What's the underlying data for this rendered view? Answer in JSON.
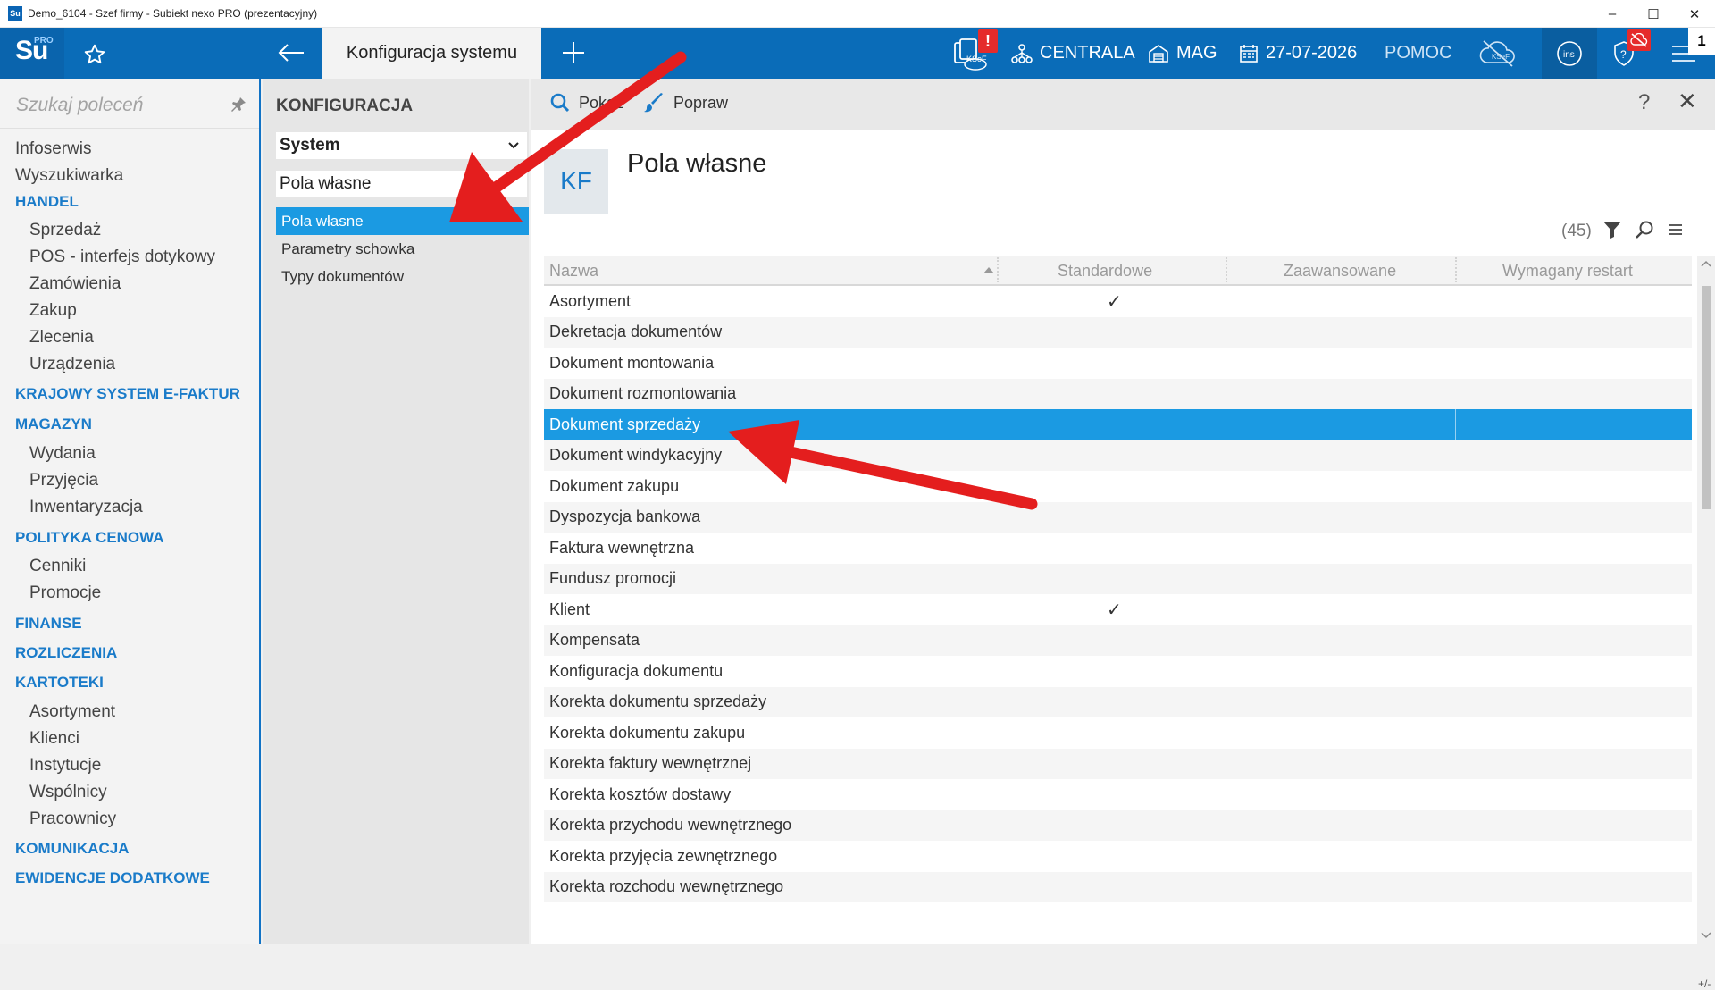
{
  "window": {
    "icon_text": "Su",
    "title": "Demo_6104 - Szef firmy - Subiekt nexo PRO (prezentacyjny)",
    "minimize": "–",
    "maximize": "☐",
    "close": "✕"
  },
  "header": {
    "logo_su": "Su",
    "logo_pro": "PRO",
    "active_tab": "Konfiguracja systemu",
    "ksef_label": "KSeF",
    "alert_badge": "!",
    "centrala": "CENTRALA",
    "mag": "MAG",
    "date": "27-07-2026",
    "pomoc": "POMOC",
    "ins_label": "ins",
    "counter": "1"
  },
  "sidebar": {
    "search_placeholder": "Szukaj poleceń",
    "items": [
      {
        "label": "Infoserwis",
        "type": "item"
      },
      {
        "label": "Wyszukiwarka",
        "type": "item"
      },
      {
        "label": "HANDEL",
        "type": "head"
      },
      {
        "label": "Sprzedaż",
        "type": "sub"
      },
      {
        "label": "POS - interfejs dotykowy",
        "type": "sub"
      },
      {
        "label": "Zamówienia",
        "type": "sub"
      },
      {
        "label": "Zakup",
        "type": "sub"
      },
      {
        "label": "Zlecenia",
        "type": "sub"
      },
      {
        "label": "Urządzenia",
        "type": "sub"
      },
      {
        "label": "KRAJOWY SYSTEM E-FAKTUR",
        "type": "head"
      },
      {
        "label": "MAGAZYN",
        "type": "head"
      },
      {
        "label": "Wydania",
        "type": "sub"
      },
      {
        "label": "Przyjęcia",
        "type": "sub"
      },
      {
        "label": "Inwentaryzacja",
        "type": "sub"
      },
      {
        "label": "POLITYKA CENOWA",
        "type": "head"
      },
      {
        "label": "Cenniki",
        "type": "sub"
      },
      {
        "label": "Promocje",
        "type": "sub"
      },
      {
        "label": "FINANSE",
        "type": "head"
      },
      {
        "label": "ROZLICZENIA",
        "type": "head"
      },
      {
        "label": "KARTOTEKI",
        "type": "head"
      },
      {
        "label": "Asortyment",
        "type": "sub"
      },
      {
        "label": "Klienci",
        "type": "sub"
      },
      {
        "label": "Instytucje",
        "type": "sub"
      },
      {
        "label": "Wspólnicy",
        "type": "sub"
      },
      {
        "label": "Pracownicy",
        "type": "sub"
      },
      {
        "label": "KOMUNIKACJA",
        "type": "head"
      },
      {
        "label": "EWIDENCJE DODATKOWE",
        "type": "head"
      }
    ]
  },
  "config": {
    "title": "KONFIGURACJA",
    "select_value": "System",
    "filter_value": "Pola własne",
    "items": [
      {
        "label": "Pola własne",
        "active": true
      },
      {
        "label": "Parametry schowka",
        "active": false
      },
      {
        "label": "Typy dokumentów",
        "active": false
      }
    ]
  },
  "toolbar": {
    "show_label": "Pokaż",
    "edit_label": "Popraw",
    "help": "?",
    "close": "✕"
  },
  "page": {
    "badge": "KF",
    "heading": "Pola własne",
    "count": "(45)"
  },
  "table": {
    "columns": [
      "Nazwa",
      "Standardowe",
      "Zaawansowane",
      "Wymagany restart"
    ],
    "check_mark": "✓",
    "rows": [
      {
        "name": "Asortyment",
        "std": true
      },
      {
        "name": "Dekretacja dokumentów",
        "std": false
      },
      {
        "name": "Dokument montowania",
        "std": false
      },
      {
        "name": "Dokument rozmontowania",
        "std": false
      },
      {
        "name": "Dokument sprzedaży",
        "std": false,
        "selected": true
      },
      {
        "name": "Dokument windykacyjny",
        "std": false
      },
      {
        "name": "Dokument zakupu",
        "std": false
      },
      {
        "name": "Dyspozycja bankowa",
        "std": false
      },
      {
        "name": "Faktura wewnętrzna",
        "std": false
      },
      {
        "name": "Fundusz promocji",
        "std": false
      },
      {
        "name": "Klient",
        "std": true
      },
      {
        "name": "Kompensata",
        "std": false
      },
      {
        "name": "Konfiguracja dokumentu",
        "std": false
      },
      {
        "name": "Korekta dokumentu sprzedaży",
        "std": false
      },
      {
        "name": "Korekta dokumentu zakupu",
        "std": false
      },
      {
        "name": "Korekta faktury wewnętrznej",
        "std": false
      },
      {
        "name": "Korekta kosztów dostawy",
        "std": false
      },
      {
        "name": "Korekta przychodu wewnętrznego",
        "std": false
      },
      {
        "name": "Korekta przyjęcia zewnętrznego",
        "std": false
      },
      {
        "name": "Korekta rozchodu wewnętrznego",
        "std": false
      }
    ]
  },
  "status": {
    "corner": "+/-"
  },
  "colors": {
    "header_blue": "#0a6cb8",
    "selection_blue": "#1b9ae2",
    "section_blue": "#1a7bc9",
    "annotation_red": "#e41e1e"
  }
}
